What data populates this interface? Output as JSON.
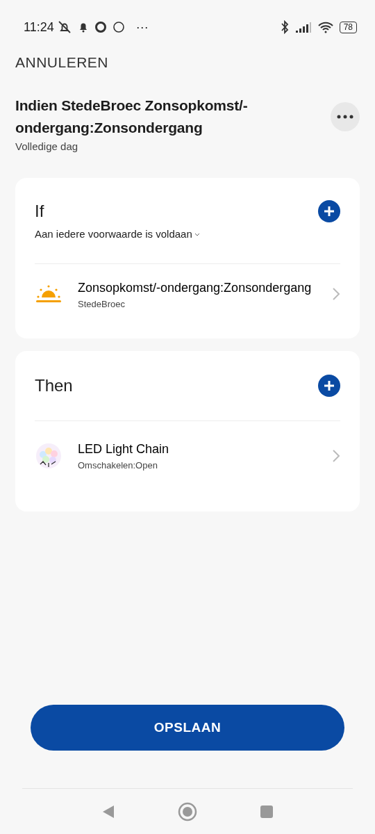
{
  "status_bar": {
    "time": "11:24",
    "battery": "78",
    "more": "···"
  },
  "cancel": "ANNULEREN",
  "header": {
    "title": "Indien StedeBroec Zonsopkomst/-ondergang:Zonsondergang",
    "subtitle": "Volledige dag"
  },
  "sections": [
    {
      "title": "If",
      "condition": "Aan iedere voorwaarde is voldaan",
      "items": [
        {
          "kind": "sun",
          "title": "Zonsopkomst/-ondergang:Zonsondergang",
          "subtitle": "StedeBroec"
        }
      ]
    },
    {
      "title": "Then",
      "items": [
        {
          "kind": "lights",
          "title": "LED Light Chain",
          "subtitle": "Omschakelen:Open"
        }
      ]
    }
  ],
  "save_button": "OPSLAAN"
}
